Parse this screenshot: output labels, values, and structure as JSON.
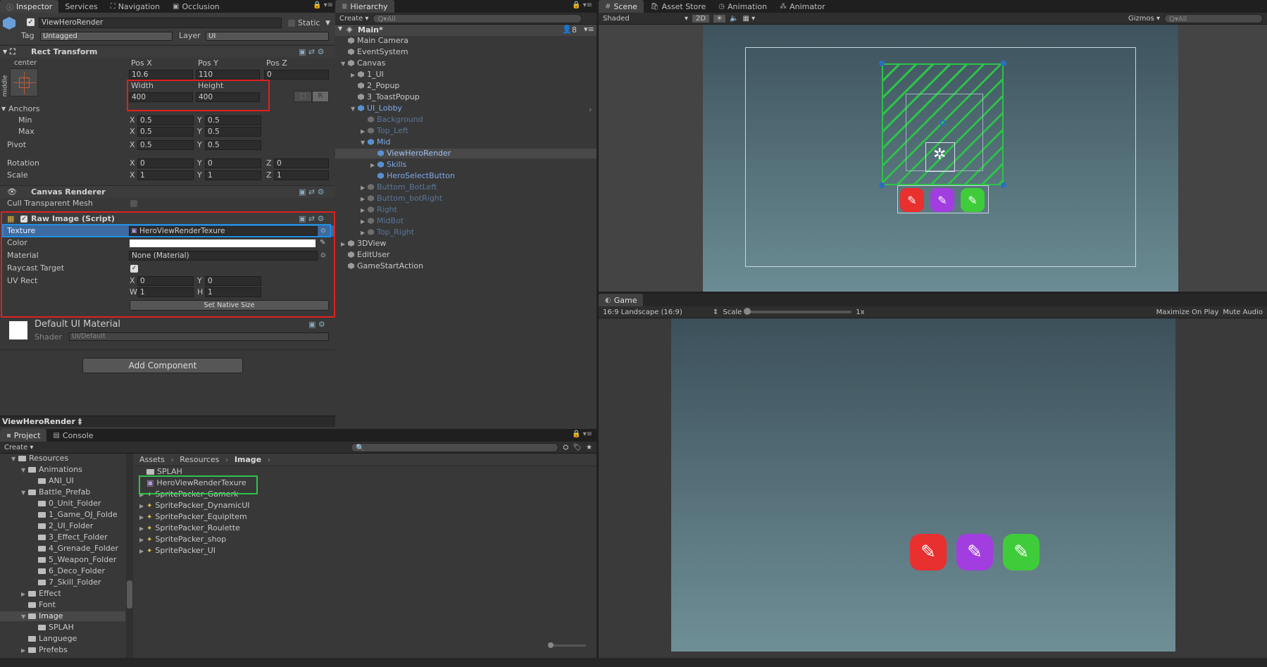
{
  "inspector": {
    "tabs": [
      "Inspector",
      "Services",
      "Navigation",
      "Occlusion"
    ],
    "object_name": "ViewHeroRender",
    "static_label": "Static",
    "tag_label": "Tag",
    "tag_value": "Untagged",
    "layer_label": "Layer",
    "layer_value": "UI",
    "rect_transform": {
      "title": "Rect Transform",
      "anchor_preset_top": "center",
      "anchor_preset_side": "middle",
      "pos_x_label": "Pos X",
      "pos_y_label": "Pos Y",
      "pos_z_label": "Pos Z",
      "pos_x": "10.6",
      "pos_y": "110",
      "pos_z": "0",
      "width_label": "Width",
      "height_label": "Height",
      "width": "400",
      "height": "400",
      "r_button": "R",
      "anchors_label": "Anchors",
      "min_label": "Min",
      "max_label": "Max",
      "min_x": "0.5",
      "min_y": "0.5",
      "max_x": "0.5",
      "max_y": "0.5",
      "pivot_label": "Pivot",
      "pivot_x": "0.5",
      "pivot_y": "0.5",
      "rotation_label": "Rotation",
      "rot_x": "0",
      "rot_y": "0",
      "rot_z": "0",
      "scale_label": "Scale",
      "scale_x": "1",
      "scale_y": "1",
      "scale_z": "1",
      "x": "X",
      "y": "Y",
      "z": "Z",
      "w": "W",
      "h": "H"
    },
    "canvas_renderer": {
      "title": "Canvas Renderer",
      "cull_label": "Cull Transparent Mesh"
    },
    "raw_image": {
      "title": "Raw Image (Script)",
      "texture_label": "Texture",
      "texture_value": "HeroViewRenderTexure",
      "color_label": "Color",
      "material_label": "Material",
      "material_value": "None (Material)",
      "raycast_label": "Raycast Target",
      "uvrect_label": "UV Rect",
      "uv_x": "0",
      "uv_y": "0",
      "uv_w": "1",
      "uv_h": "1",
      "native_button": "Set Native Size"
    },
    "material_block": {
      "name": "Default UI Material",
      "shader_label": "Shader",
      "shader_value": "UI/Default"
    },
    "add_component": "Add Component",
    "footer_title": "ViewHeroRender ‡"
  },
  "hierarchy": {
    "tab": "Hierarchy",
    "create": "Create ▾",
    "search_placeholder": "Q▾All",
    "scene_name": "Main*",
    "count": "8",
    "items": [
      {
        "label": "Main Camera",
        "depth": 1,
        "arrow": "",
        "style": "normal"
      },
      {
        "label": "EventSystem",
        "depth": 1,
        "arrow": "",
        "style": "normal"
      },
      {
        "label": "Canvas",
        "depth": 1,
        "arrow": "▼",
        "style": "normal"
      },
      {
        "label": "1_UI",
        "depth": 2,
        "arrow": "▶",
        "style": "normal"
      },
      {
        "label": "2_Popup",
        "depth": 2,
        "arrow": "",
        "style": "normal"
      },
      {
        "label": "3_ToastPopup",
        "depth": 2,
        "arrow": "",
        "style": "normal"
      },
      {
        "label": "UI_Lobby",
        "depth": 2,
        "arrow": "▼",
        "style": "prefab"
      },
      {
        "label": "Background",
        "depth": 3,
        "arrow": "",
        "style": "inactive"
      },
      {
        "label": "Top_Left",
        "depth": 3,
        "arrow": "▶",
        "style": "inactive"
      },
      {
        "label": "Mid",
        "depth": 3,
        "arrow": "▼",
        "style": "prefab"
      },
      {
        "label": "ViewHeroRender",
        "depth": 4,
        "arrow": "",
        "style": "selected"
      },
      {
        "label": "Skills",
        "depth": 4,
        "arrow": "▶",
        "style": "prefab"
      },
      {
        "label": "HeroSelectButton",
        "depth": 4,
        "arrow": "",
        "style": "prefab"
      },
      {
        "label": "Buttom_BotLeft",
        "depth": 3,
        "arrow": "▶",
        "style": "inactive"
      },
      {
        "label": "Buttom_botRight",
        "depth": 3,
        "arrow": "▶",
        "style": "inactive"
      },
      {
        "label": "Right",
        "depth": 3,
        "arrow": "▶",
        "style": "inactive"
      },
      {
        "label": "MidBot",
        "depth": 3,
        "arrow": "▶",
        "style": "inactive"
      },
      {
        "label": "Top_Right",
        "depth": 3,
        "arrow": "▶",
        "style": "inactive"
      },
      {
        "label": "3DView",
        "depth": 1,
        "arrow": "▶",
        "style": "normal"
      },
      {
        "label": "EditUser",
        "depth": 1,
        "arrow": "",
        "style": "normal"
      },
      {
        "label": "GameStartAction",
        "depth": 1,
        "arrow": "",
        "style": "normal"
      }
    ]
  },
  "scene": {
    "tabs": [
      "Scene",
      "Asset Store",
      "Animation",
      "Animator"
    ],
    "shaded": "Shaded",
    "mode_2d": "2D",
    "gizmos": "Gizmos ▾",
    "search_placeholder": "Q▾All"
  },
  "game": {
    "tab": "Game",
    "aspect": "16:9 Landscape (16:9)",
    "scale_label": "Scale",
    "scale_value": "1x",
    "maximize": "Maximize On Play",
    "mute": "Mute Audio"
  },
  "project": {
    "tabs": [
      "Project",
      "Console"
    ],
    "create": "Create ▾",
    "tree": [
      {
        "label": "Resources",
        "depth": 1,
        "arrow": "▼",
        "style": "normal"
      },
      {
        "label": "Animations",
        "depth": 2,
        "arrow": "▼",
        "style": "normal"
      },
      {
        "label": "ANI_UI",
        "depth": 3,
        "arrow": "",
        "style": "normal"
      },
      {
        "label": "Battle_Prefab",
        "depth": 2,
        "arrow": "▼",
        "style": "normal"
      },
      {
        "label": "0_Unit_Folder",
        "depth": 3,
        "arrow": "",
        "style": "normal"
      },
      {
        "label": "1_Game_OJ_Folde",
        "depth": 3,
        "arrow": "",
        "style": "normal"
      },
      {
        "label": "2_UI_Folder",
        "depth": 3,
        "arrow": "",
        "style": "normal"
      },
      {
        "label": "3_Effect_Folder",
        "depth": 3,
        "arrow": "",
        "style": "normal"
      },
      {
        "label": "4_Grenade_Folder",
        "depth": 3,
        "arrow": "",
        "style": "normal"
      },
      {
        "label": "5_Weapon_Folder",
        "depth": 3,
        "arrow": "",
        "style": "normal"
      },
      {
        "label": "6_Deco_Folder",
        "depth": 3,
        "arrow": "",
        "style": "normal"
      },
      {
        "label": "7_Skill_Folder",
        "depth": 3,
        "arrow": "",
        "style": "normal"
      },
      {
        "label": "Effect",
        "depth": 2,
        "arrow": "▶",
        "style": "normal"
      },
      {
        "label": "Font",
        "depth": 2,
        "arrow": "",
        "style": "normal"
      },
      {
        "label": "Image",
        "depth": 2,
        "arrow": "▼",
        "style": "selected"
      },
      {
        "label": "SPLAH",
        "depth": 3,
        "arrow": "",
        "style": "normal"
      },
      {
        "label": "Languege",
        "depth": 2,
        "arrow": "",
        "style": "normal"
      },
      {
        "label": "Prefebs",
        "depth": 2,
        "arrow": "▶",
        "style": "normal"
      }
    ],
    "breadcrumb": [
      "Assets",
      "Resources",
      "Image"
    ],
    "files": [
      {
        "label": "SPLAH",
        "icon": "folder"
      },
      {
        "label": "HeroViewRenderTexure",
        "icon": "render-texture"
      },
      {
        "label": "SpritePacker_Gamerk",
        "icon": "atlas"
      },
      {
        "label": "SpritePacker_DynamicUI",
        "icon": "atlas"
      },
      {
        "label": "SpritePacker_EquipItem",
        "icon": "atlas"
      },
      {
        "label": "SpritePacker_Roulette",
        "icon": "atlas"
      },
      {
        "label": "SpritePacker_shop",
        "icon": "atlas"
      },
      {
        "label": "SpritePacker_UI",
        "icon": "atlas"
      }
    ]
  },
  "colors": {
    "annotation_red": "#e02020",
    "annotation_blue": "#1f8fe0",
    "annotation_green": "#2ec24a",
    "skill_red": "#e8302f",
    "skill_purple": "#a23de0",
    "skill_green": "#3fcc3a"
  }
}
